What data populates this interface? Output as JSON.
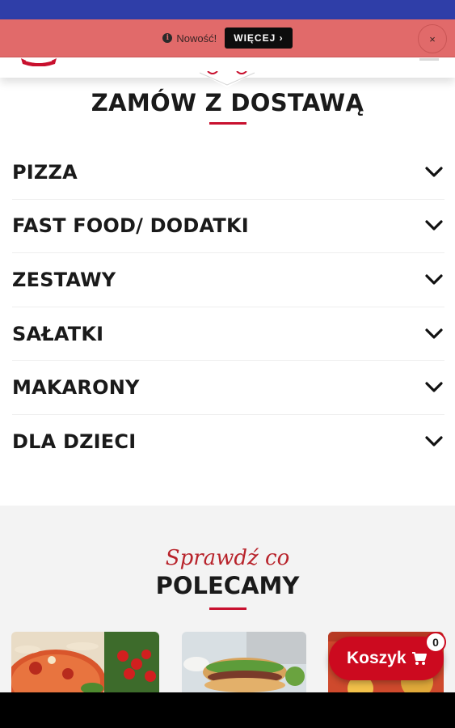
{
  "notice": {
    "text": "Nowość!",
    "more_label": "WIĘCEJ ›",
    "close_label": "×"
  },
  "order_section": {
    "title": "ZAMÓW Z DOSTAWĄ"
  },
  "categories": [
    {
      "label": "PIZZA"
    },
    {
      "label": "FAST FOOD/ DODATKI"
    },
    {
      "label": "ZESTAWY"
    },
    {
      "label": "SAŁATKI"
    },
    {
      "label": "MAKARONY"
    },
    {
      "label": "DLA DZIECI"
    }
  ],
  "recommend": {
    "script_title": "Sprawdź co",
    "title": "POLECAMY"
  },
  "cart": {
    "label": "Koszyk",
    "count": "0"
  },
  "colors": {
    "status_bar": "#2f3ea8",
    "notice_bar": "#e16a6a",
    "accent_red": "#c8102e",
    "cart_red": "#cc0a1f"
  }
}
